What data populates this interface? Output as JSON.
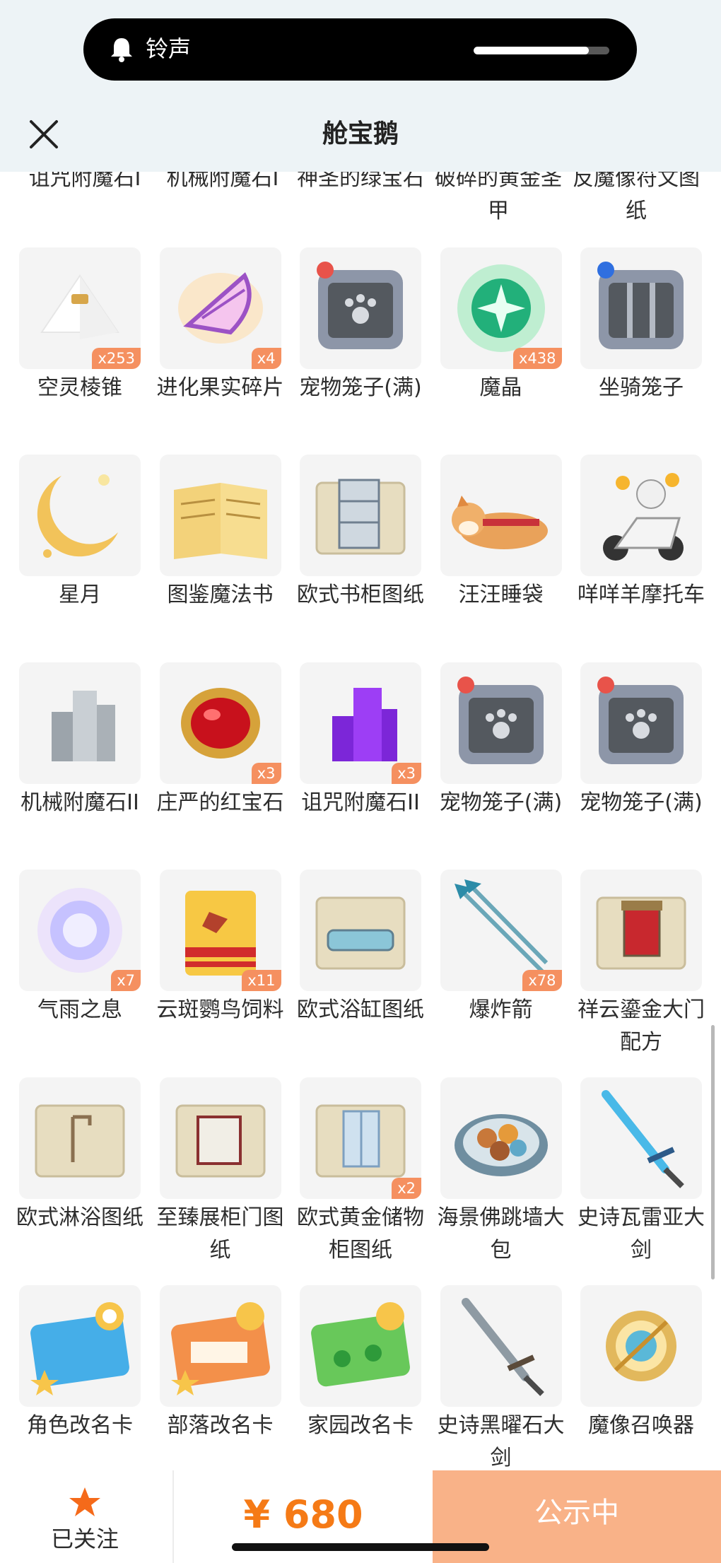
{
  "notification": {
    "label": "铃声",
    "volume_fraction": 0.85
  },
  "header": {
    "title": "舱宝鹅"
  },
  "top_partial_names": [
    "诅咒附魔石I",
    "机械附魔石I",
    "神圣的绿宝石",
    "破碎的黄金圣甲",
    "反魔像符文图纸"
  ],
  "rows": [
    [
      {
        "name": "空灵棱锥",
        "qty": "x253",
        "icon": "pyramid-icon"
      },
      {
        "name": "进化果实碎片",
        "qty": "x4",
        "icon": "fruit-slice-icon"
      },
      {
        "name": "宠物笼子(满)",
        "qty": "",
        "icon": "pet-cage-icon"
      },
      {
        "name": "魔晶",
        "qty": "x438",
        "icon": "magic-crystal-icon"
      },
      {
        "name": "坐骑笼子",
        "qty": "",
        "icon": "mount-cage-icon"
      }
    ],
    [
      {
        "name": "星月",
        "qty": "",
        "icon": "crescent-moon-icon"
      },
      {
        "name": "图鉴魔法书",
        "qty": "",
        "icon": "book-icon"
      },
      {
        "name": "欧式书柜图纸",
        "qty": "",
        "icon": "blueprint-bookshelf-icon"
      },
      {
        "name": "汪汪睡袋",
        "qty": "",
        "icon": "dog-sleeping-bag-icon"
      },
      {
        "name": "咩咩羊摩托车",
        "qty": "",
        "icon": "scooter-icon"
      }
    ],
    [
      {
        "name": "机械附魔石II",
        "qty": "",
        "icon": "mech-stone-icon"
      },
      {
        "name": "庄严的红宝石",
        "qty": "x3",
        "icon": "ruby-icon"
      },
      {
        "name": "诅咒附魔石II",
        "qty": "x3",
        "icon": "curse-stone-icon"
      },
      {
        "name": "宠物笼子(满)",
        "qty": "",
        "icon": "pet-cage-icon"
      },
      {
        "name": "宠物笼子(满)",
        "qty": "",
        "icon": "pet-cage-icon"
      }
    ],
    [
      {
        "name": "气雨之息",
        "qty": "x7",
        "icon": "orb-icon"
      },
      {
        "name": "云斑鹦鸟饲料",
        "qty": "x11",
        "icon": "feed-bag-icon"
      },
      {
        "name": "欧式浴缸图纸",
        "qty": "",
        "icon": "blueprint-bathtub-icon"
      },
      {
        "name": "爆炸箭",
        "qty": "x78",
        "icon": "arrow-icon"
      },
      {
        "name": "祥云鎏金大门配方",
        "qty": "",
        "icon": "blueprint-gate-icon"
      }
    ],
    [
      {
        "name": "欧式淋浴图纸",
        "qty": "",
        "icon": "blueprint-shower-icon"
      },
      {
        "name": "至臻展柜门图纸",
        "qty": "",
        "icon": "blueprint-cabinet-icon"
      },
      {
        "name": "欧式黄金储物柜图纸",
        "qty": "x2",
        "icon": "blueprint-locker-icon"
      },
      {
        "name": "海景佛跳墙大包",
        "qty": "",
        "icon": "food-plate-icon"
      },
      {
        "name": "史诗瓦雷亚大剑",
        "qty": "",
        "icon": "blue-sword-icon"
      }
    ],
    [
      {
        "name": "角色改名卡",
        "qty": "",
        "icon": "rename-card-blue-icon"
      },
      {
        "name": "部落改名卡",
        "qty": "",
        "icon": "rename-card-orange-icon"
      },
      {
        "name": "家园改名卡",
        "qty": "",
        "icon": "rename-card-green-icon"
      },
      {
        "name": "史诗黑曜石大剑",
        "qty": "",
        "icon": "black-sword-icon"
      },
      {
        "name": "魔像召唤器",
        "qty": "",
        "icon": "golem-summoner-icon"
      }
    ]
  ],
  "bottom_bar": {
    "follow_label": "已关注",
    "price": "¥ 680",
    "status": "公示中"
  },
  "colors": {
    "accent": "#f57a16",
    "badge": "#f59060",
    "status_button": "#f9b288",
    "header_bg": "#edf3f6"
  }
}
